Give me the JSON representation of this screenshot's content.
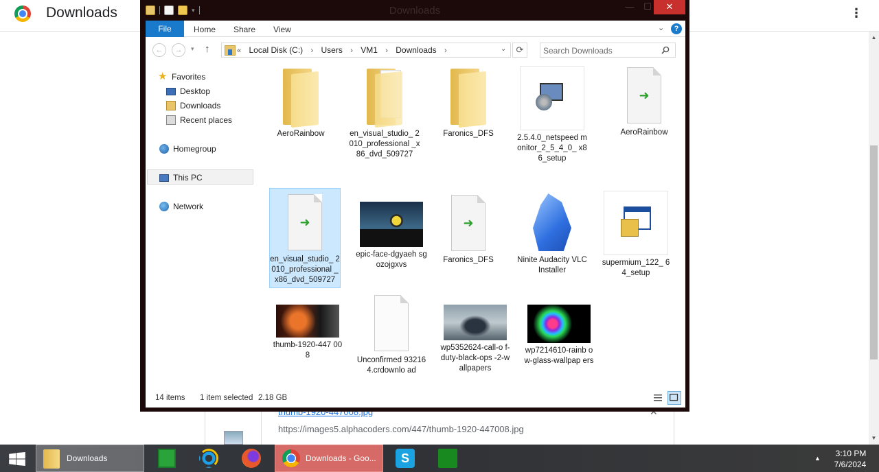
{
  "browser": {
    "title": "Downloads",
    "menu_icon": "⋮",
    "download": {
      "filename": "thumb-1920-447008.jpg",
      "url": "https://images5.alphacoders.com/447/thumb-1920-447008.jpg",
      "close": "✕"
    }
  },
  "explorer": {
    "title": "Downloads",
    "window_controls": {
      "minimize": "—",
      "maximize": "☐",
      "close": "✕"
    },
    "ribbon": {
      "file": "File",
      "tabs": [
        "Home",
        "Share",
        "View"
      ],
      "help": "?"
    },
    "address": {
      "overflow": "«",
      "crumbs": [
        "Local Disk (C:)",
        "Users",
        "VM1",
        "Downloads"
      ]
    },
    "search_placeholder": "Search Downloads",
    "nav_pane": {
      "favorites": "Favorites",
      "favorites_items": [
        "Desktop",
        "Downloads",
        "Recent places"
      ],
      "homegroup": "Homegroup",
      "this_pc": "This PC",
      "network": "Network"
    },
    "files": [
      {
        "name": "AeroRainbow",
        "type": "folder"
      },
      {
        "name": "en_visual_studio_2010_professional_x86_dvd_509727",
        "type": "folder-docs"
      },
      {
        "name": "Faronics_DFS",
        "type": "folder"
      },
      {
        "name": "2.5.4.0_netspeedmonitor_2_5_4_0_x86_setup",
        "type": "setup"
      },
      {
        "name": "AeroRainbow",
        "type": "shortcut"
      },
      {
        "name": "en_visual_studio_2010_professional_x86_dvd_509727",
        "type": "shortcut",
        "selected": true
      },
      {
        "name": "epic-face-dgyaehsgozojgxvs",
        "type": "image"
      },
      {
        "name": "Faronics_DFS",
        "type": "shortcut"
      },
      {
        "name": "Ninite Audacity VLC Installer",
        "type": "ninite"
      },
      {
        "name": "supermium_122_64_setup",
        "type": "setup2"
      },
      {
        "name": "thumb-1920-447008",
        "type": "image"
      },
      {
        "name": "Unconfirmed 932164.crdownload",
        "type": "blank"
      },
      {
        "name": "wp5352624-call-of-duty-black-ops-2-wallpapers",
        "type": "image"
      },
      {
        "name": "wp7214610-rainbow-glass-wallpapers",
        "type": "image"
      }
    ],
    "labels": {
      "f0": "AeroRainbow",
      "f1": "en_visual_studio_ 2010_professional _x86_dvd_509727",
      "f2": "Faronics_DFS",
      "f3": "2.5.4.0_netspeed monitor_2_5_4_0_ x86_setup",
      "f4": "AeroRainbow",
      "f5": "en_visual_studio_ 2010_professional _x86_dvd_509727",
      "f6": "epic-face-dgyaeh sgozojgxvs",
      "f7": "Faronics_DFS",
      "f8": "Ninite Audacity VLC Installer",
      "f9": "supermium_122_ 64_setup",
      "f10": "thumb-1920-447 008",
      "f11": "Unconfirmed 932164.crdownlo ad",
      "f12": "wp5352624-call-o f-duty-black-ops -2-wallpapers",
      "f13": "wp7214610-rainb ow-glass-wallpap ers"
    },
    "status": {
      "count": "14 items",
      "selected": "1 item selected",
      "size": "2.18 GB"
    }
  },
  "taskbar": {
    "downloads_label": "Downloads",
    "chrome_label": "Downloads - Goo...",
    "tray_arrow": "▲",
    "time": "3:10 PM",
    "date": "7/6/2024"
  }
}
